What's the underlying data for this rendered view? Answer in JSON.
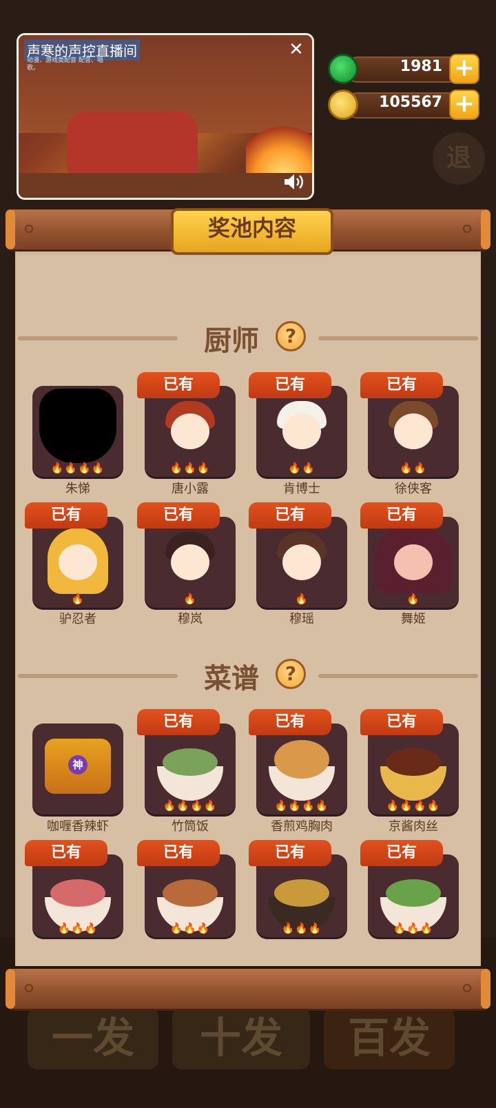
{
  "video": {
    "title": "声寒的声控直播间",
    "subtitle": "动漫、游戏类配音 配音、唱歌。"
  },
  "currency": {
    "jade": "1981",
    "coins": "105567",
    "plus": "+"
  },
  "background": {
    "back_label": "退",
    "buttons": [
      "一发",
      "十发",
      "百发"
    ]
  },
  "panel": {
    "title": "奖池内容"
  },
  "chef_section": {
    "title": "厨师",
    "help": "?",
    "owned_label": "已有",
    "items": [
      {
        "name": "朱悌",
        "owned": false,
        "flames": "🔥🔥🔥🔥"
      },
      {
        "name": "唐小露",
        "owned": true,
        "flames": "🔥🔥🔥"
      },
      {
        "name": "肯博士",
        "owned": true,
        "flames": "🔥🔥"
      },
      {
        "name": "徐侠客",
        "owned": true,
        "flames": "🔥🔥"
      },
      {
        "name": "驴忍者",
        "owned": true,
        "flames": "🔥"
      },
      {
        "name": "穆岚",
        "owned": true,
        "flames": "🔥"
      },
      {
        "name": "穆瑶",
        "owned": true,
        "flames": "🔥"
      },
      {
        "name": "舞姬",
        "owned": true,
        "flames": "🔥"
      }
    ]
  },
  "recipe_section": {
    "title": "菜谱",
    "help": "?",
    "owned_label": "已有",
    "badge": "神",
    "items": [
      {
        "name": "咖喱香辣虾",
        "owned": false,
        "flames": ""
      },
      {
        "name": "竹筒饭",
        "owned": true,
        "flames": "🔥🔥🔥🔥"
      },
      {
        "name": "香煎鸡胸肉",
        "owned": true,
        "flames": "🔥🔥🔥🔥"
      },
      {
        "name": "京酱肉丝",
        "owned": true,
        "flames": "🔥🔥🔥🔥"
      },
      {
        "name": "",
        "owned": true,
        "flames": "🔥🔥🔥"
      },
      {
        "name": "",
        "owned": true,
        "flames": "🔥🔥🔥"
      },
      {
        "name": "",
        "owned": true,
        "flames": "🔥🔥🔥"
      },
      {
        "name": "",
        "owned": true,
        "flames": "🔥🔥🔥"
      }
    ]
  }
}
